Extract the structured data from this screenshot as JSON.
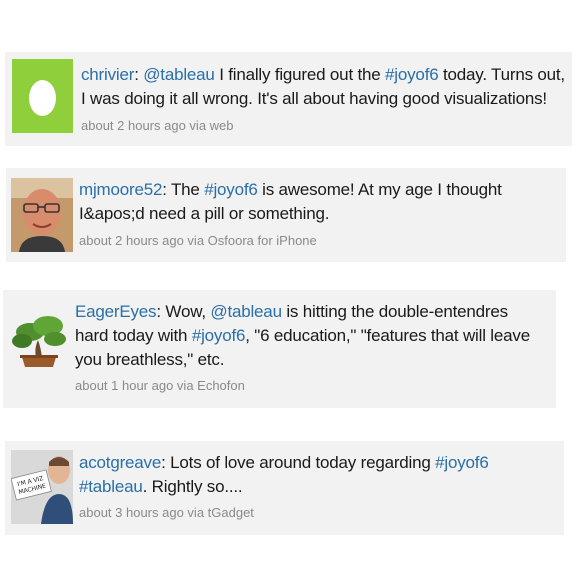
{
  "tweets": [
    {
      "username": "chrivier",
      "text_parts": [
        ": ",
        "@tableau",
        " I finally figured out the ",
        "#joyof6",
        " today. Turns out, I was doing it all wrong. It's all about having good visualizations!"
      ],
      "timestamp": "about 2 hours ago",
      "via": " via web",
      "avatar_icon": "egg-avatar"
    },
    {
      "username": "mjmoore52",
      "text_parts": [
        ": The ",
        "#joyof6",
        " is awesome! At my age I thought I&apos;d need a pill or something."
      ],
      "timestamp": "about 2 hours ago",
      "via": " via Osfoora for iPhone",
      "avatar_icon": "man-with-glasses-avatar"
    },
    {
      "username": "EagerEyes",
      "text_parts": [
        ": Wow, ",
        "@tableau",
        " is hitting the double-entendres hard today with ",
        "#joyof6",
        ", \"6 education,\" \"features that will leave you breathless,\" etc."
      ],
      "timestamp": "about 1 hour ago",
      "via": " via Echofon",
      "avatar_icon": "bonsai-tree-avatar"
    },
    {
      "username": "acotgreave",
      "text_parts": [
        ": Lots of love around today regarding ",
        "#joyof6",
        " ",
        "#tableau",
        ". Rightly so...."
      ],
      "timestamp": "about 3 hours ago",
      "via": " via tGadget",
      "avatar_icon": "viz-machine-sign-avatar",
      "avatar_sign_text": "I'M A VIZ MACHINE"
    }
  ],
  "colors": {
    "link": "#2a6fa8",
    "text": "#1a1a1a",
    "meta": "#8a8a8a",
    "card_bg": "#f2f2f2",
    "egg_bg": "#8fcf3c"
  }
}
